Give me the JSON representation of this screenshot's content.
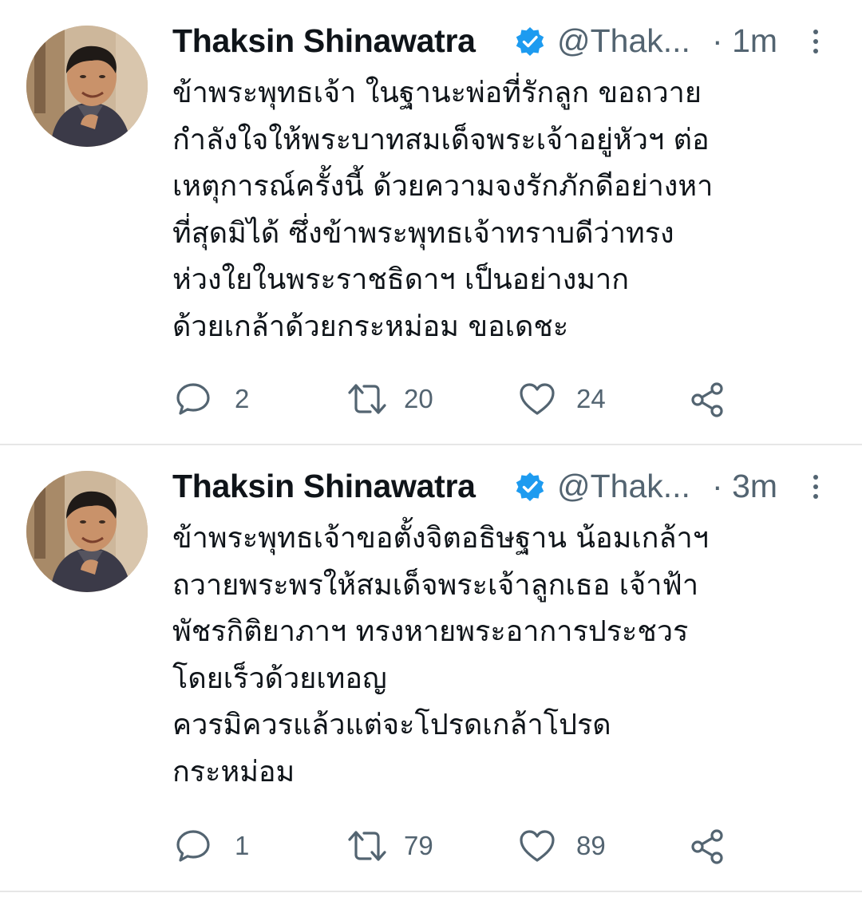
{
  "tweets": [
    {
      "author": {
        "name": "Thaksin Shinawatra",
        "handle": "@Thak...",
        "verified": true
      },
      "separator": "·",
      "time": "1m",
      "lines": [
        "ข้าพระพุทธเจ้า ในฐานะพ่อที่รักลูก ขอถวาย",
        "กำลังใจให้พระบาทสมเด็จพระเจ้าอยู่หัวฯ ต่อ",
        "เหตุการณ์ครั้งนี้ ด้วยความจงรักภักดีอย่างหา",
        "ที่สุดมิได้ ซึ่งข้าพระพุทธเจ้าทราบดีว่าทรง",
        "ห่วงใยในพระราชธิดาฯ เป็นอย่างมาก",
        "ด้วยเกล้าด้วยกระหม่อม ขอเดชะ"
      ],
      "stats": {
        "replies": "2",
        "retweets": "20",
        "likes": "24"
      }
    },
    {
      "author": {
        "name": "Thaksin Shinawatra",
        "handle": "@Thak...",
        "verified": true
      },
      "separator": "·",
      "time": "3m",
      "lines": [
        "ข้าพระพุทธเจ้าขอตั้งจิตอธิษฐาน น้อมเกล้าฯ",
        "ถวายพระพรให้สมเด็จพระเจ้าลูกเธอ เจ้าฟ้า",
        "พัชรกิติยาภาฯ ทรงหายพระอาการประชวร",
        "โดยเร็วด้วยเทอญ",
        "ควรมิควรแล้วแต่จะโปรดเกล้าโปรด",
        "กระหม่อม"
      ],
      "stats": {
        "replies": "1",
        "retweets": "79",
        "likes": "89"
      }
    }
  ],
  "colors": {
    "text": "#0f1419",
    "secondary": "#536471",
    "verified": "#1d9bf0",
    "divider": "#e6e6e6"
  },
  "icons": {
    "verified": "verified-badge-icon",
    "more": "more-vertical-icon",
    "reply": "reply-bubble-icon",
    "retweet": "retweet-arrows-icon",
    "like": "heart-outline-icon",
    "share": "share-nodes-icon"
  }
}
